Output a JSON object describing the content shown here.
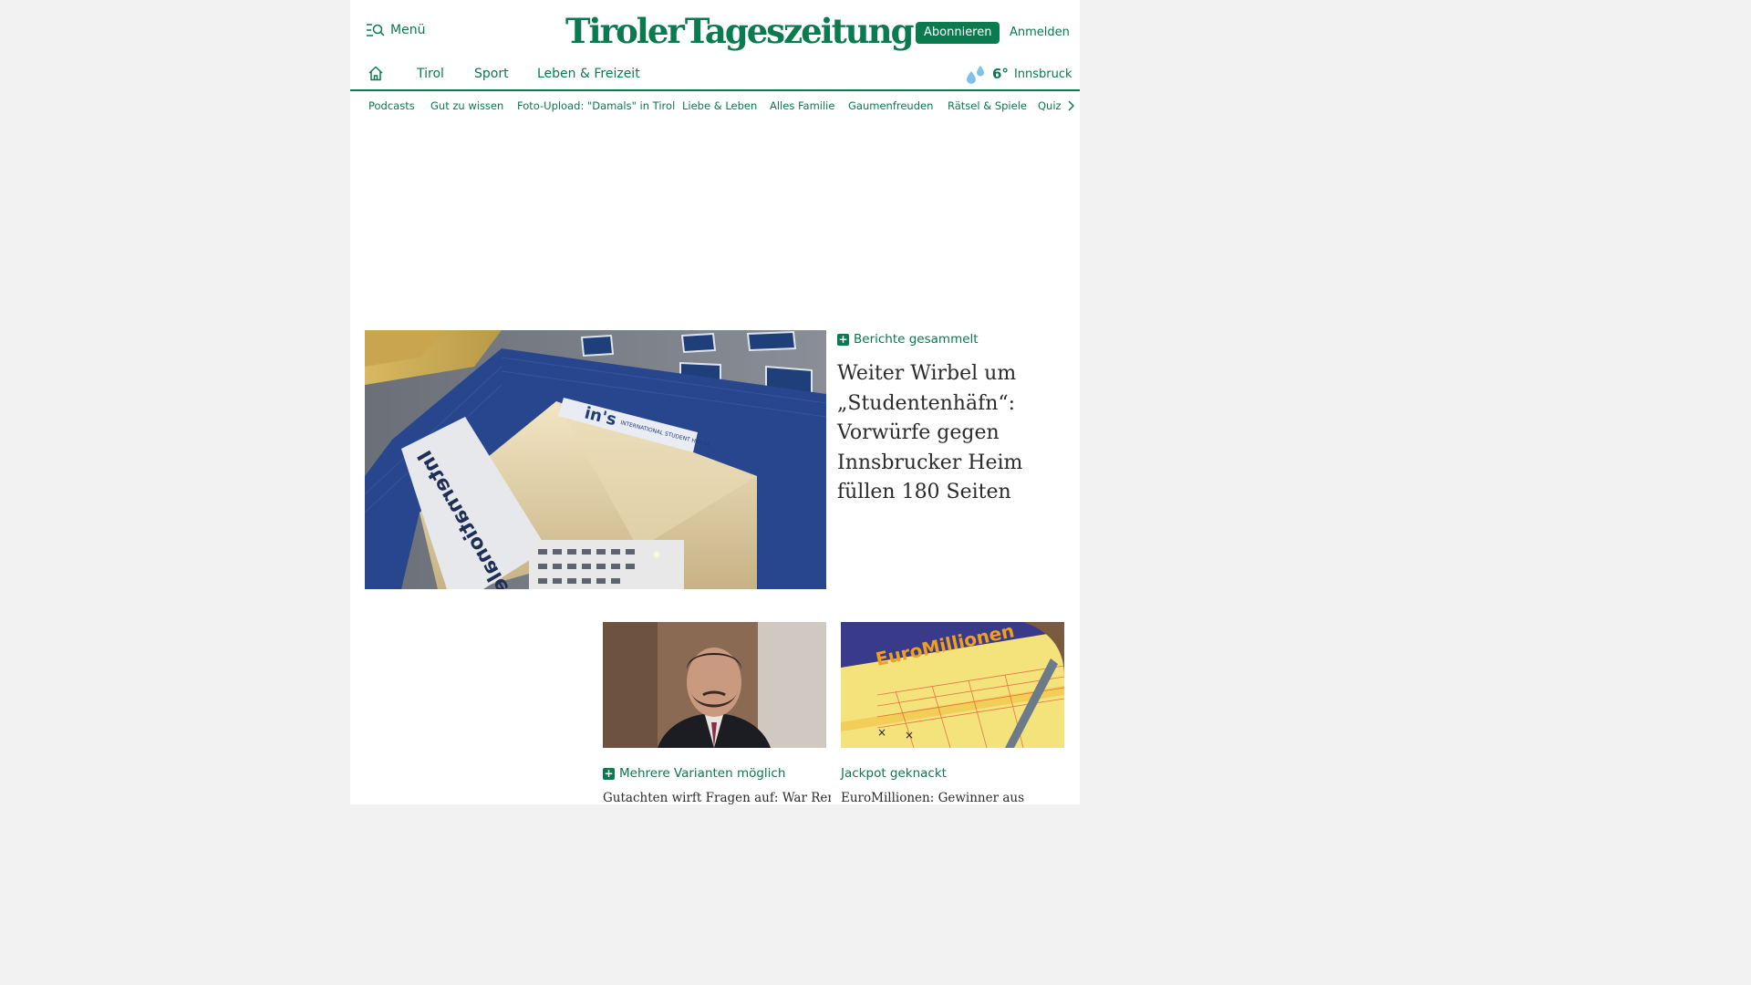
{
  "header": {
    "menu_label": "Menü",
    "logo_part1": "Tiroler",
    "logo_part2": "Tageszeitung",
    "subscribe_label": "Abonnieren",
    "login_label": "Anmelden"
  },
  "mainnav": {
    "items": [
      {
        "label": "Tirol"
      },
      {
        "label": "Sport"
      },
      {
        "label": "Leben & Freizeit"
      }
    ]
  },
  "weather": {
    "temperature": "6°",
    "city": "Innsbruck",
    "icon": "rain-drops-icon"
  },
  "subnav": {
    "items": [
      {
        "label": "Podcasts"
      },
      {
        "label": "Gut zu wissen"
      },
      {
        "label": "Foto-Upload: \"Damals\" in Tirol"
      },
      {
        "label": "Liebe & Leben"
      },
      {
        "label": "Alles Familie"
      },
      {
        "label": "Gaumenfreuden"
      },
      {
        "label": "Rätsel & Spiele"
      },
      {
        "label": "Quiz"
      }
    ]
  },
  "lead": {
    "kicker": "Berichte gesammelt",
    "title": "Weiter Wirbel um „Studentenhäfn“: Vorwürfe gegen Innsbrucker Heim füllen 180 Seiten",
    "image_sign_text": "in's",
    "image_sign_sub": "INTERNATIONAL STUDENT HOUSE",
    "image_banner_text": "Internationales STUDENTENHAUS"
  },
  "teasers": [
    {
      "kicker": "Mehrere Varianten möglich",
      "premium": true,
      "title": "Gutachten wirft Fragen auf: War René"
    },
    {
      "kicker": "Jackpot geknackt",
      "premium": false,
      "title": "EuroMillionen: Gewinner aus",
      "image_text": "EuroMillionen"
    }
  ],
  "colors": {
    "brand_green": "#0a7a4f",
    "eagle_red": "#c8102e",
    "headline_text": "#2b2b2b"
  }
}
